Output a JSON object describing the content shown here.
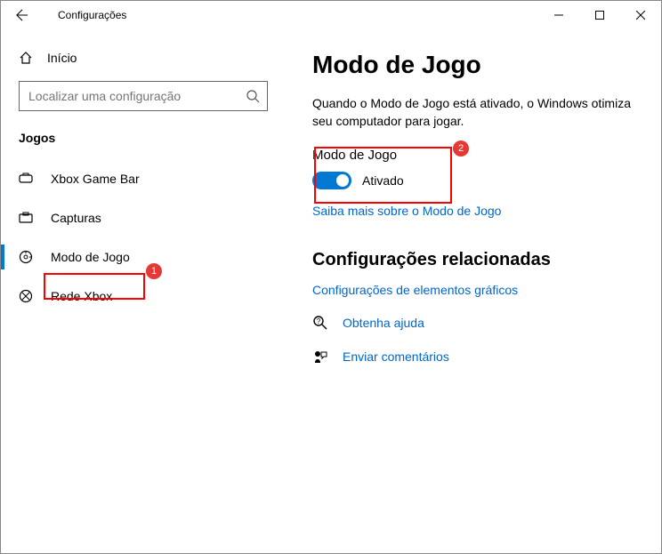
{
  "window": {
    "title": "Configurações"
  },
  "sidebar": {
    "home_label": "Início",
    "search_placeholder": "Localizar uma configuração",
    "section_header": "Jogos",
    "items": [
      {
        "label": "Xbox Game Bar"
      },
      {
        "label": "Capturas"
      },
      {
        "label": "Modo de Jogo"
      },
      {
        "label": "Rede Xbox"
      }
    ]
  },
  "main": {
    "page_title": "Modo de Jogo",
    "description": "Quando o Modo de Jogo está ativado, o Windows otimiza seu computador para jogar.",
    "toggle_label": "Modo de Jogo",
    "toggle_state": "Ativado",
    "learn_more": "Saiba mais sobre o Modo de Jogo",
    "related_heading": "Configurações relacionadas",
    "graphics_link": "Configurações de elementos gráficos",
    "help_link": "Obtenha ajuda",
    "feedback_link": "Enviar comentários"
  },
  "annotations": {
    "badge1": "1",
    "badge2": "2"
  }
}
